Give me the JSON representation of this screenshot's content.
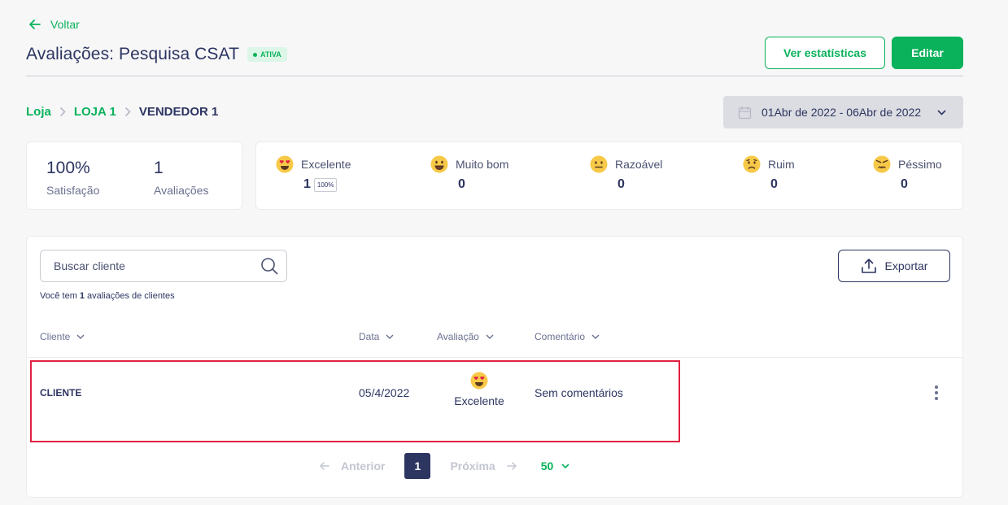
{
  "nav": {
    "back_label": "Voltar"
  },
  "header": {
    "title": "Avaliações: Pesquisa CSAT",
    "status": "ATIVA",
    "stats_button": "Ver estatísticas",
    "edit_button": "Editar"
  },
  "breadcrumb": {
    "items": [
      "Loja",
      "LOJA 1",
      "VENDEDOR 1"
    ]
  },
  "date_range": {
    "label": "01Abr de 2022 - 06Abr de 2022"
  },
  "summary": {
    "satisfaction_value": "100%",
    "satisfaction_label": "Satisfação",
    "reviews_value": "1",
    "reviews_label": "Avaliações"
  },
  "ratings": [
    {
      "label": "Excelente",
      "count": "1",
      "percent": "100%",
      "icon": "heart-eyes-face-icon"
    },
    {
      "label": "Muito bom",
      "count": "0",
      "icon": "grin-face-icon"
    },
    {
      "label": "Razoável",
      "count": "0",
      "icon": "neutral-face-icon"
    },
    {
      "label": "Ruim",
      "count": "0",
      "icon": "frown-face-icon"
    },
    {
      "label": "Péssimo",
      "count": "0",
      "icon": "angry-face-icon"
    }
  ],
  "table": {
    "search_placeholder": "Buscar cliente",
    "export_label": "Exportar",
    "count_prefix": "Você tem",
    "count_value": "1",
    "count_suffix": "avaliações de clientes",
    "columns": [
      "Cliente",
      "Data",
      "Avaliação",
      "Comentário"
    ],
    "rows": [
      {
        "client": "CLIENTE",
        "date": "05/4/2022",
        "rating": "Excelente",
        "comment": "Sem comentários"
      }
    ]
  },
  "pagination": {
    "prev_label": "Anterior",
    "current_page": "1",
    "next_label": "Próxima",
    "page_size": "50"
  },
  "colors": {
    "accent": "#0ab25b",
    "text": "#2d3561",
    "highlight": "#e0203f",
    "emoji_face": "#f7c948"
  }
}
